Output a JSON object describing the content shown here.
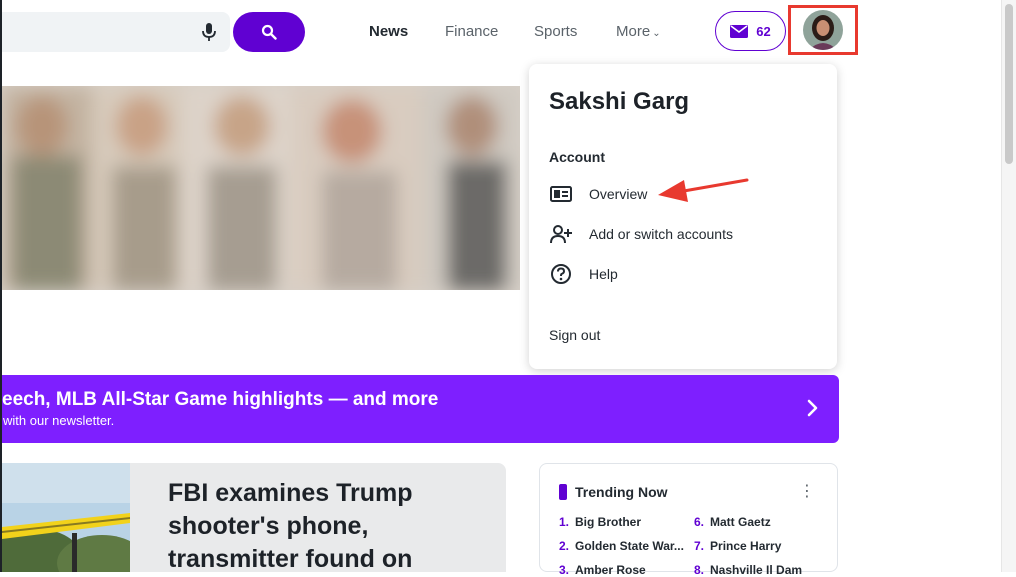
{
  "header": {
    "nav": [
      "News",
      "Finance",
      "Sports",
      "More"
    ],
    "mail_count": "62"
  },
  "account_menu": {
    "user_name": "Sakshi Garg",
    "section_label": "Account",
    "items": [
      {
        "label": "Overview",
        "icon": "id-card-icon"
      },
      {
        "label": "Add or switch accounts",
        "icon": "add-user-icon"
      },
      {
        "label": "Help",
        "icon": "help-icon"
      }
    ],
    "sign_out": "Sign out"
  },
  "banner": {
    "title": "eech, MLB All-Star Game highlights — and more",
    "subtitle": "with our newsletter."
  },
  "story": {
    "title": "FBI examines Trump shooter's phone, transmitter found on"
  },
  "trending": {
    "title": "Trending Now",
    "items": [
      {
        "num": "1.",
        "label": "Big Brother"
      },
      {
        "num": "2.",
        "label": "Golden State War..."
      },
      {
        "num": "3.",
        "label": "Amber Rose"
      },
      {
        "num": "6.",
        "label": "Matt Gaetz"
      },
      {
        "num": "7.",
        "label": "Prince Harry"
      },
      {
        "num": "8.",
        "label": "Nashville Il Dam"
      }
    ]
  },
  "colors": {
    "brand_purple": "#6001d2",
    "banner_purple": "#7e1fff",
    "highlight_red": "#e8392f"
  }
}
